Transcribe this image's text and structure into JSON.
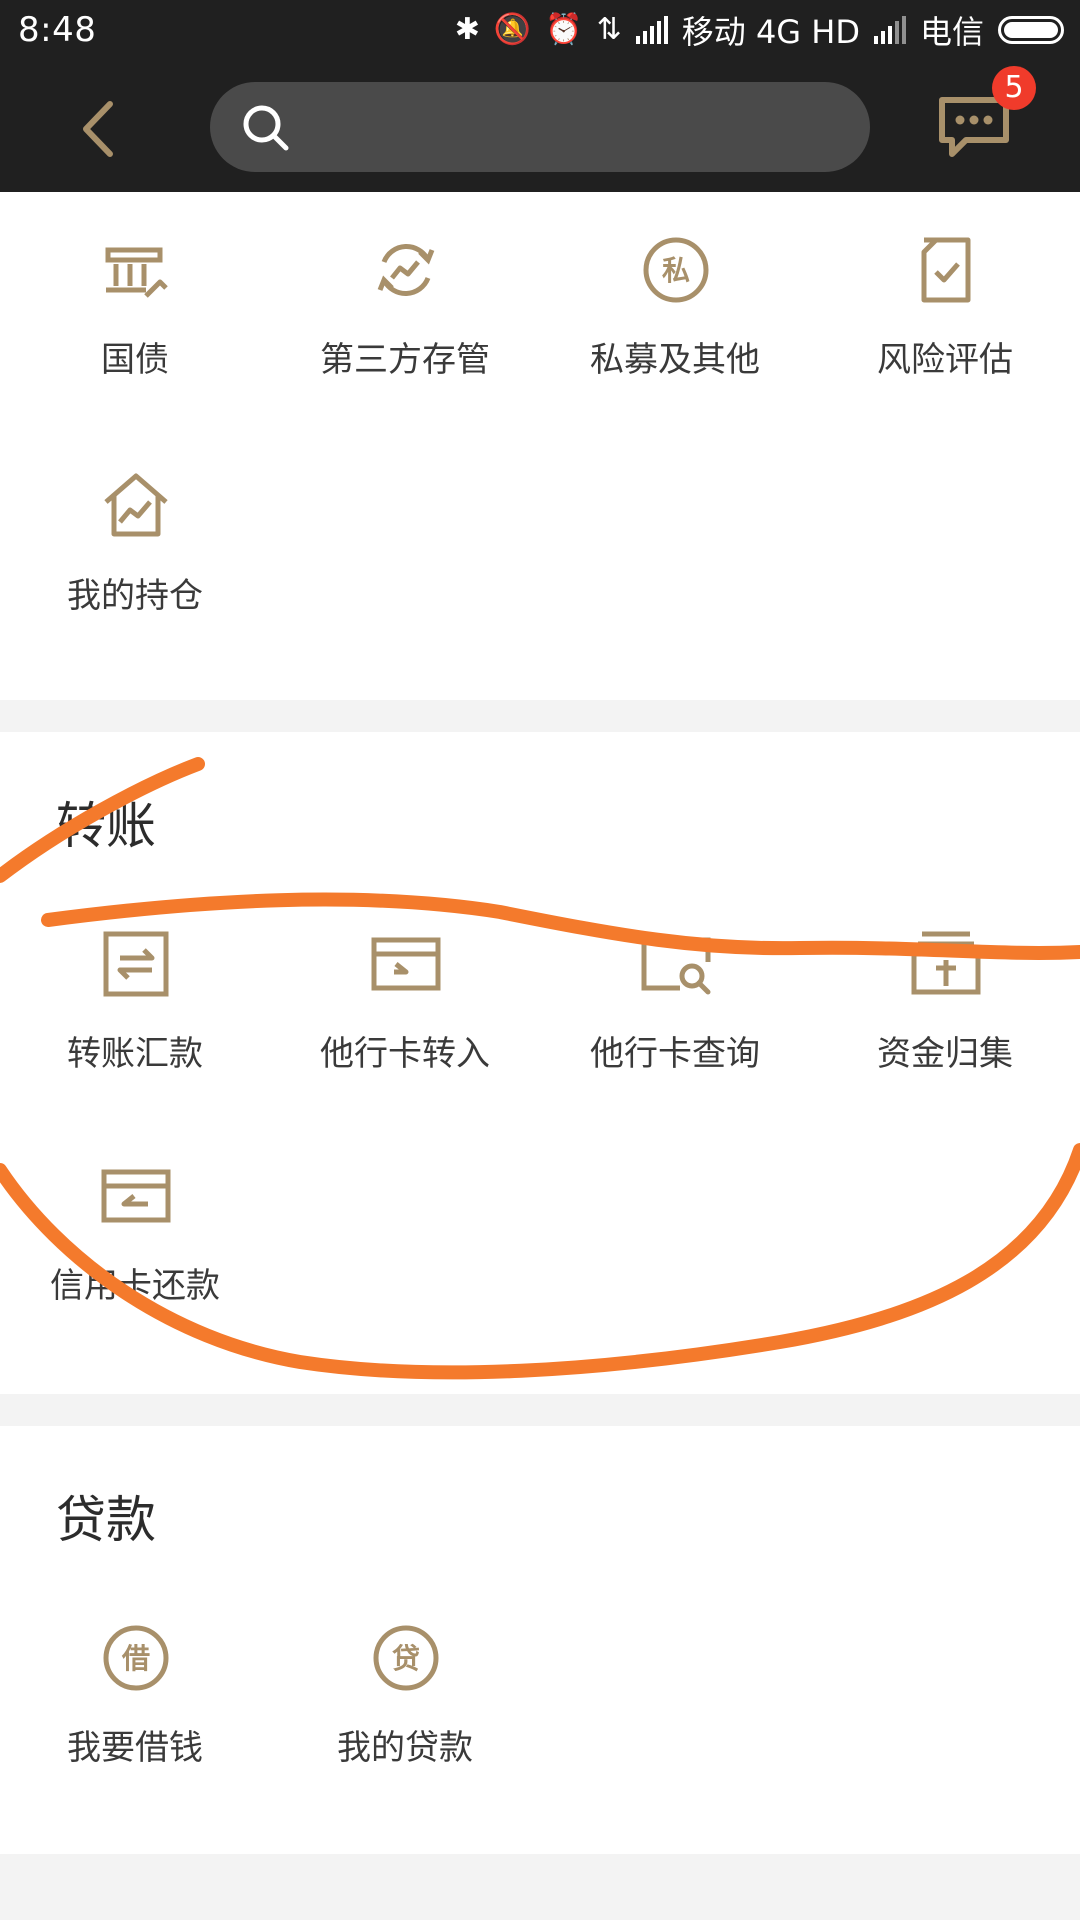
{
  "status_bar": {
    "time": "8:48",
    "carrier1": "移动 4G HD",
    "carrier2": "电信"
  },
  "header": {
    "search_placeholder": "",
    "message_badge": "5"
  },
  "section_invest": {
    "items": [
      {
        "label": "国债",
        "icon": "bank-bond-icon"
      },
      {
        "label": "第三方存管",
        "icon": "custody-cycle-icon"
      },
      {
        "label": "私募及其他",
        "icon": "private-fund-icon"
      },
      {
        "label": "风险评估",
        "icon": "risk-document-icon"
      },
      {
        "label": "我的持仓",
        "icon": "holdings-house-icon"
      }
    ]
  },
  "section_transfer": {
    "title": "转账",
    "items": [
      {
        "label": "转账汇款",
        "icon": "transfer-icon"
      },
      {
        "label": "他行卡转入",
        "icon": "card-transfer-in-icon"
      },
      {
        "label": "他行卡查询",
        "icon": "card-search-icon"
      },
      {
        "label": "资金归集",
        "icon": "fund-collect-icon"
      },
      {
        "label": "信用卡还款",
        "icon": "credit-card-repay-icon"
      }
    ]
  },
  "section_loan": {
    "title": "贷款",
    "items": [
      {
        "label": "我要借钱",
        "icon": "borrow-icon",
        "glyph": "借"
      },
      {
        "label": "我的贷款",
        "icon": "loan-icon",
        "glyph": "贷"
      }
    ]
  },
  "colors": {
    "dark_header": "#202020",
    "accent_icon": "#a8906a",
    "badge": "#f03b2b",
    "scribble": "#f47a2c"
  }
}
